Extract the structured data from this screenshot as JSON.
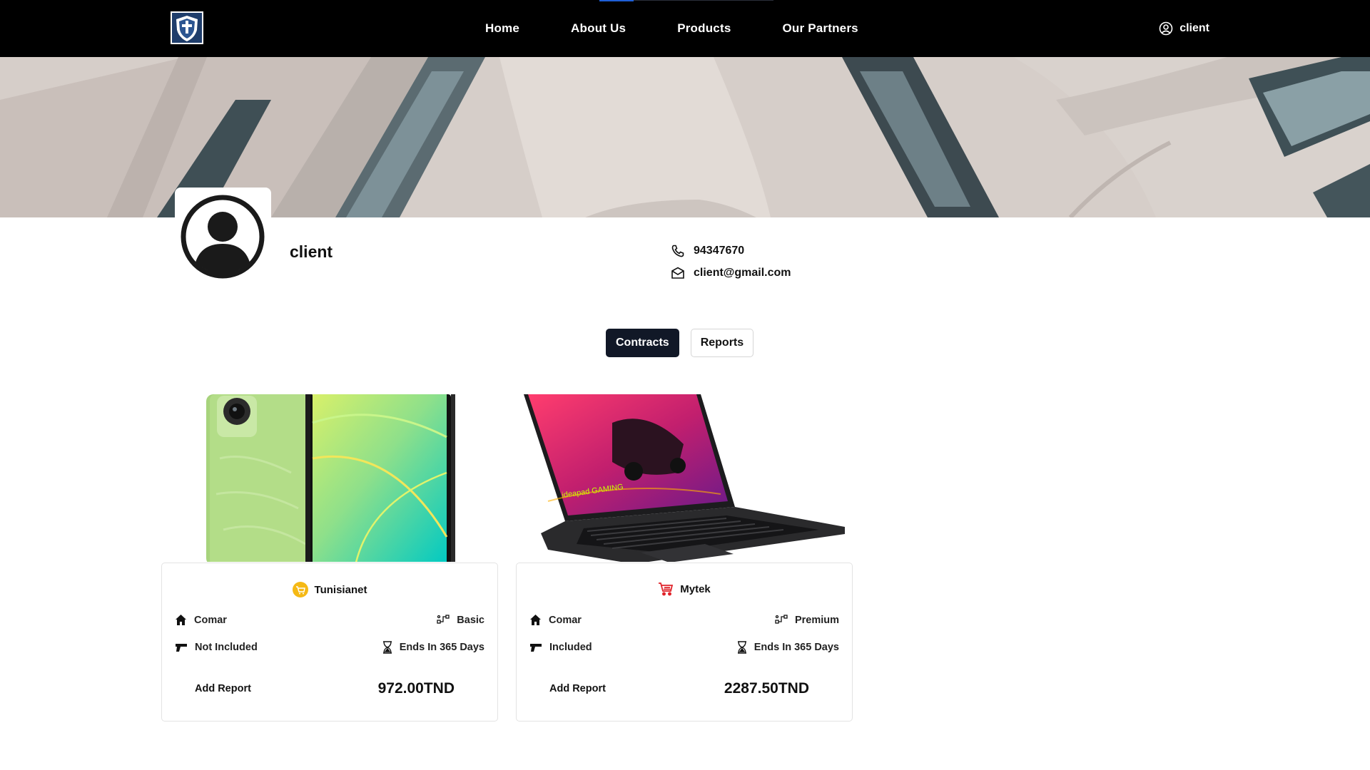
{
  "nav": {
    "items": [
      "Home",
      "About Us",
      "Products",
      "Our Partners"
    ],
    "user_label": "client"
  },
  "profile": {
    "name": "client",
    "phone": "94347670",
    "email": "client@gmail.com"
  },
  "tabs": [
    {
      "label": "Contracts",
      "active": true
    },
    {
      "label": "Reports",
      "active": false
    }
  ],
  "contracts": [
    {
      "store": "Tunisianet",
      "store_icon": "cart-badge-icon",
      "insurer": "Comar",
      "plan": "Basic",
      "theft": "Not Included",
      "duration": "Ends In 365 Days",
      "action": "Add Report",
      "price": "972.00TND",
      "product_image": "green smartphone"
    },
    {
      "store": "Mytek",
      "store_icon": "red-cart-icon",
      "insurer": "Comar",
      "plan": "Premium",
      "theft": "Included",
      "duration": "Ends In 365 Days",
      "action": "Add Report",
      "price": "2287.50TND",
      "product_image": "gaming laptop"
    }
  ],
  "colors": {
    "nav_bg": "#000000",
    "active_tab": "#111827",
    "accent": "#1e5fd6"
  }
}
